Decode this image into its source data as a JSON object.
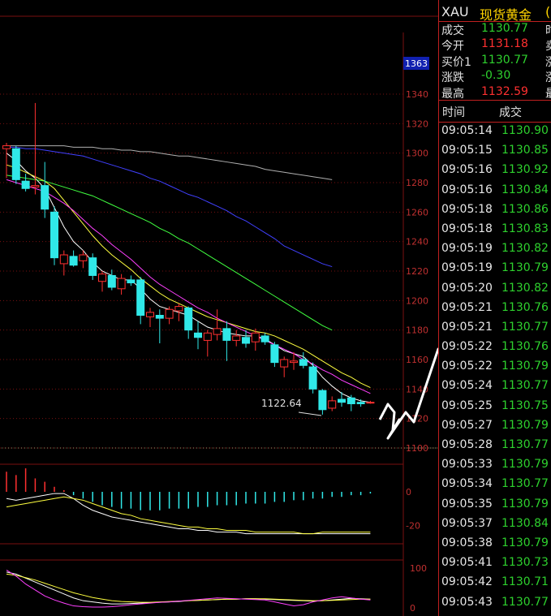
{
  "quote": {
    "symbol": "XAU",
    "name": "现货黄金",
    "name_suffix": "(",
    "rows": [
      {
        "label": "成交",
        "value": "1130.77",
        "color": "#2ed12e",
        "cut": "时"
      },
      {
        "label": "今开",
        "value": "1131.18",
        "color": "#ff3030",
        "cut": "卖"
      },
      {
        "label": "买价1",
        "value": "1130.77",
        "color": "#2ed12e",
        "cut": "涨"
      },
      {
        "label": "涨跌",
        "value": "-0.30",
        "color": "#2ed12e",
        "cut": "涨"
      },
      {
        "label": "最高",
        "value": "1132.59",
        "color": "#ff3030",
        "cut": "最"
      }
    ]
  },
  "ticks": {
    "header_time": "时间",
    "header_price": "成交",
    "rows": [
      {
        "time": "09:05:14",
        "price": "1130.90"
      },
      {
        "time": "09:05:15",
        "price": "1130.85"
      },
      {
        "time": "09:05:16",
        "price": "1130.92"
      },
      {
        "time": "09:05:16",
        "price": "1130.84"
      },
      {
        "time": "09:05:18",
        "price": "1130.86"
      },
      {
        "time": "09:05:18",
        "price": "1130.83"
      },
      {
        "time": "09:05:19",
        "price": "1130.82"
      },
      {
        "time": "09:05:19",
        "price": "1130.79"
      },
      {
        "time": "09:05:20",
        "price": "1130.82"
      },
      {
        "time": "09:05:21",
        "price": "1130.76"
      },
      {
        "time": "09:05:21",
        "price": "1130.77"
      },
      {
        "time": "09:05:22",
        "price": "1130.76"
      },
      {
        "time": "09:05:22",
        "price": "1130.79"
      },
      {
        "time": "09:05:24",
        "price": "1130.77"
      },
      {
        "time": "09:05:25",
        "price": "1130.75"
      },
      {
        "time": "09:05:27",
        "price": "1130.79"
      },
      {
        "time": "09:05:28",
        "price": "1130.77"
      },
      {
        "time": "09:05:33",
        "price": "1130.79"
      },
      {
        "time": "09:05:34",
        "price": "1130.77"
      },
      {
        "time": "09:05:35",
        "price": "1130.79"
      },
      {
        "time": "09:05:37",
        "price": "1130.84"
      },
      {
        "time": "09:05:38",
        "price": "1130.79"
      },
      {
        "time": "09:05:41",
        "price": "1130.73"
      },
      {
        "time": "09:05:42",
        "price": "1130.71"
      },
      {
        "time": "09:05:43",
        "price": "1130.77"
      }
    ]
  },
  "colors": {
    "up": "#ff3030",
    "down": "#30e8e8",
    "grid": "#7a1010",
    "axis": "#c03030"
  },
  "chart_data": [
    {
      "type": "candlestick",
      "y_ticks": [
        1340,
        1320,
        1300,
        1280,
        1260,
        1240,
        1220,
        1200,
        1180,
        1160,
        1140,
        1120,
        1100
      ],
      "ylim": [
        1100,
        1340
      ],
      "top_label": "1363",
      "min_label": "1122.64",
      "candles": [
        {
          "o": 1303,
          "h": 1307,
          "l": 1283,
          "c": 1305
        },
        {
          "o": 1303,
          "h": 1305,
          "l": 1279,
          "c": 1282
        },
        {
          "o": 1281,
          "h": 1286,
          "l": 1274,
          "c": 1276
        },
        {
          "o": 1277,
          "h": 1334,
          "l": 1272,
          "c": 1278
        },
        {
          "o": 1278,
          "h": 1294,
          "l": 1256,
          "c": 1262
        },
        {
          "o": 1260,
          "h": 1264,
          "l": 1224,
          "c": 1229
        },
        {
          "o": 1225,
          "h": 1234,
          "l": 1217,
          "c": 1231
        },
        {
          "o": 1230,
          "h": 1234,
          "l": 1223,
          "c": 1224
        },
        {
          "o": 1227,
          "h": 1234,
          "l": 1222,
          "c": 1231
        },
        {
          "o": 1229,
          "h": 1232,
          "l": 1214,
          "c": 1217
        },
        {
          "o": 1213,
          "h": 1220,
          "l": 1206,
          "c": 1218
        },
        {
          "o": 1217,
          "h": 1221,
          "l": 1207,
          "c": 1209
        },
        {
          "o": 1208,
          "h": 1218,
          "l": 1204,
          "c": 1215
        },
        {
          "o": 1214,
          "h": 1217,
          "l": 1210,
          "c": 1212
        },
        {
          "o": 1214,
          "h": 1216,
          "l": 1184,
          "c": 1190
        },
        {
          "o": 1189,
          "h": 1195,
          "l": 1182,
          "c": 1192
        },
        {
          "o": 1190,
          "h": 1194,
          "l": 1171,
          "c": 1188
        },
        {
          "o": 1188,
          "h": 1196,
          "l": 1184,
          "c": 1194
        },
        {
          "o": 1193,
          "h": 1198,
          "l": 1186,
          "c": 1196
        },
        {
          "o": 1195,
          "h": 1196,
          "l": 1174,
          "c": 1180
        },
        {
          "o": 1178,
          "h": 1186,
          "l": 1167,
          "c": 1175
        },
        {
          "o": 1173,
          "h": 1180,
          "l": 1162,
          "c": 1178
        },
        {
          "o": 1177,
          "h": 1194,
          "l": 1173,
          "c": 1181
        },
        {
          "o": 1181,
          "h": 1186,
          "l": 1159,
          "c": 1173
        },
        {
          "o": 1173,
          "h": 1180,
          "l": 1169,
          "c": 1176
        },
        {
          "o": 1175,
          "h": 1180,
          "l": 1168,
          "c": 1171
        },
        {
          "o": 1172,
          "h": 1181,
          "l": 1166,
          "c": 1178
        },
        {
          "o": 1176,
          "h": 1178,
          "l": 1170,
          "c": 1172
        },
        {
          "o": 1170,
          "h": 1172,
          "l": 1155,
          "c": 1158
        },
        {
          "o": 1155,
          "h": 1162,
          "l": 1148,
          "c": 1160
        },
        {
          "o": 1158,
          "h": 1165,
          "l": 1153,
          "c": 1159
        },
        {
          "o": 1160,
          "h": 1165,
          "l": 1154,
          "c": 1156
        },
        {
          "o": 1155,
          "h": 1158,
          "l": 1137,
          "c": 1140
        },
        {
          "o": 1139,
          "h": 1140,
          "l": 1122.64,
          "c": 1126
        },
        {
          "o": 1127,
          "h": 1135,
          "l": 1125,
          "c": 1132
        },
        {
          "o": 1133,
          "h": 1138,
          "l": 1128,
          "c": 1131
        },
        {
          "o": 1134,
          "h": 1136,
          "l": 1125,
          "c": 1130
        },
        {
          "o": 1131,
          "h": 1133,
          "l": 1128,
          "c": 1130
        },
        {
          "o": 1131,
          "h": 1132,
          "l": 1130,
          "c": 1131
        }
      ],
      "series": [
        {
          "color": "#ffffff",
          "values": [
            1300,
            1295,
            1288,
            1283,
            1276,
            1263,
            1250,
            1240,
            1234,
            1226,
            1220,
            1217,
            1214,
            1214,
            1208,
            1201,
            1196,
            1194,
            1192,
            1190,
            1186,
            1182,
            1180,
            1178,
            1177,
            1176,
            1176,
            1174,
            1170,
            1166,
            1164,
            1162,
            1156,
            1148,
            1142,
            1137,
            1134,
            1132,
            1131
          ]
        },
        {
          "color": "#ffff40",
          "values": [
            1292,
            1290,
            1287,
            1284,
            1281,
            1276,
            1268,
            1260,
            1252,
            1244,
            1237,
            1231,
            1226,
            1221,
            1215,
            1210,
            1205,
            1201,
            1198,
            1195,
            1192,
            1189,
            1187,
            1185,
            1183,
            1181,
            1179,
            1178,
            1176,
            1173,
            1170,
            1167,
            1163,
            1159,
            1155,
            1151,
            1148,
            1144,
            1141
          ]
        },
        {
          "color": "#ff40ff",
          "values": [
            1282,
            1280,
            1278,
            1276,
            1274,
            1270,
            1266,
            1261,
            1255,
            1249,
            1244,
            1238,
            1233,
            1228,
            1222,
            1216,
            1211,
            1207,
            1203,
            1199,
            1195,
            1192,
            1188,
            1185,
            1182,
            1179,
            1176,
            1173,
            1170,
            1167,
            1164,
            1160,
            1157,
            1153,
            1150,
            1146,
            1143,
            1140,
            1137
          ]
        },
        {
          "color": "#40ff40",
          "values": [
            1285,
            1284,
            1283,
            1282,
            1281,
            1279,
            1277,
            1275,
            1273,
            1271,
            1268,
            1265,
            1262,
            1259,
            1256,
            1253,
            1249,
            1246,
            1242,
            1239,
            1235,
            1231,
            1227,
            1223,
            1219,
            1215,
            1211,
            1207,
            1203,
            1199,
            1195,
            1191,
            1187,
            1183,
            1180
          ]
        },
        {
          "color": "#4040ff",
          "values": [
            1304,
            1304,
            1303,
            1303,
            1302,
            1301,
            1300,
            1299,
            1298,
            1296,
            1294,
            1292,
            1290,
            1288,
            1286,
            1283,
            1281,
            1278,
            1275,
            1272,
            1270,
            1267,
            1264,
            1261,
            1257,
            1254,
            1250,
            1246,
            1242,
            1237,
            1234,
            1231,
            1228,
            1225,
            1223
          ]
        },
        {
          "color": "#b0b0b0",
          "values": [
            1305,
            1305,
            1305,
            1305,
            1305,
            1305,
            1305,
            1304,
            1304,
            1304,
            1303,
            1303,
            1302,
            1302,
            1301,
            1301,
            1300,
            1299,
            1298,
            1298,
            1297,
            1296,
            1295,
            1294,
            1293,
            1292,
            1291,
            1289,
            1288,
            1287,
            1286,
            1285,
            1284,
            1283,
            1282
          ]
        }
      ]
    },
    {
      "type": "histogram",
      "y_ticks": [
        0,
        -20
      ],
      "ylim": [
        -30,
        15
      ],
      "bars": [
        12,
        10,
        14,
        8,
        6,
        3,
        1,
        -2,
        -4,
        -6,
        -8,
        -9,
        -10,
        -10,
        -11,
        -11,
        -11,
        -10,
        -10,
        -10,
        -9,
        -9,
        -8,
        -8,
        -8,
        -7,
        -7,
        -7,
        -6,
        -6,
        -5,
        -5,
        -4,
        -4,
        -3,
        -3,
        -2,
        -2,
        -1
      ],
      "series": [
        {
          "color": "#ffffff",
          "values": [
            -4,
            -5,
            -4,
            -3,
            -2,
            -1,
            -1,
            -4,
            -8,
            -11,
            -13,
            -15,
            -16,
            -17,
            -18,
            -19,
            -20,
            -21,
            -22,
            -22,
            -23,
            -23,
            -24,
            -24,
            -24,
            -25,
            -25,
            -25,
            -25,
            -25,
            -25,
            -25,
            -25,
            -25,
            -25,
            -25,
            -25,
            -25,
            -25
          ]
        },
        {
          "color": "#ffff40",
          "values": [
            -9,
            -8,
            -7,
            -6,
            -5,
            -4,
            -3,
            -4,
            -5,
            -7,
            -9,
            -11,
            -13,
            -14,
            -16,
            -17,
            -18,
            -19,
            -20,
            -21,
            -21,
            -22,
            -22,
            -23,
            -23,
            -23,
            -24,
            -24,
            -24,
            -24,
            -24,
            -25,
            -25,
            -24,
            -24,
            -24,
            -24,
            -24,
            -24
          ]
        }
      ]
    },
    {
      "type": "line",
      "y_ticks": [
        100,
        0
      ],
      "ylim": [
        0,
        100
      ],
      "series": [
        {
          "color": "#ffffff",
          "values": [
            90,
            85,
            75,
            65,
            55,
            45,
            35,
            25,
            18,
            15,
            12,
            10,
            10,
            11,
            12,
            13,
            14,
            15,
            16,
            18,
            19,
            20,
            21,
            22,
            22,
            23,
            23,
            22,
            21,
            20,
            19,
            18,
            17,
            18,
            20,
            22,
            24,
            23,
            22
          ]
        },
        {
          "color": "#ffff40",
          "values": [
            85,
            82,
            76,
            70,
            62,
            54,
            46,
            38,
            32,
            26,
            22,
            18,
            16,
            15,
            14,
            14,
            15,
            16,
            17,
            18,
            19,
            20,
            21,
            22,
            22,
            23,
            23,
            23,
            22,
            21,
            20,
            19,
            18,
            18,
            19,
            20,
            21,
            22,
            22
          ]
        },
        {
          "color": "#ff40ff",
          "values": [
            95,
            80,
            60,
            45,
            30,
            20,
            12,
            5,
            3,
            2,
            2,
            3,
            5,
            8,
            10,
            12,
            14,
            15,
            17,
            19,
            21,
            23,
            25,
            24,
            23,
            22,
            21,
            20,
            15,
            10,
            5,
            8,
            15,
            20,
            25,
            28,
            25,
            22,
            20
          ]
        }
      ]
    }
  ]
}
